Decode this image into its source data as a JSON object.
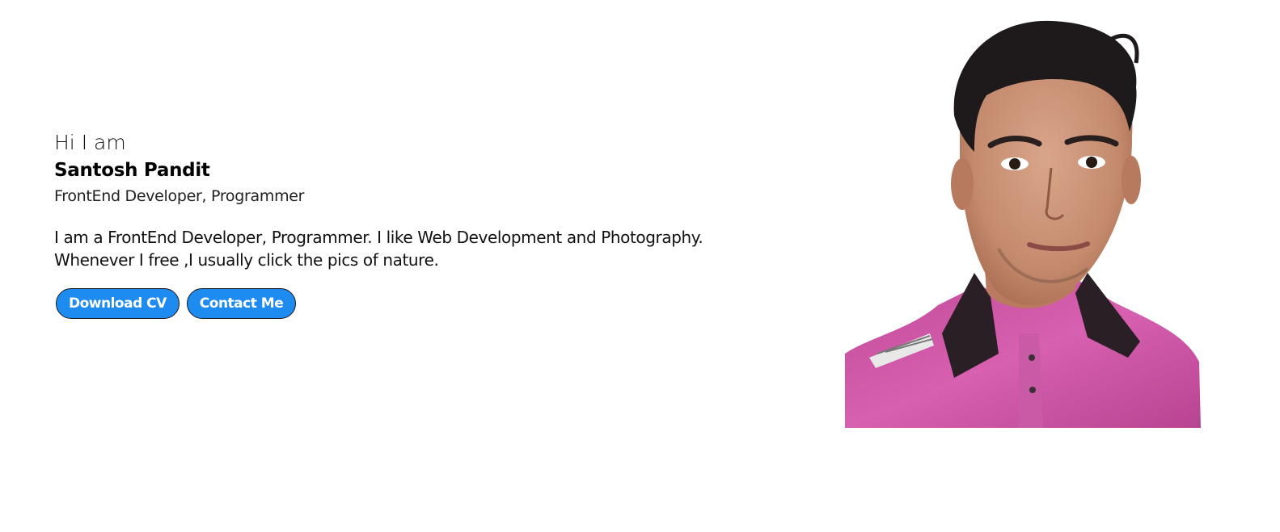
{
  "hero": {
    "greeting": "Hi I am",
    "name": "Santosh Pandit",
    "role": "FrontEnd Developer, Programmer",
    "bio_line1": "I am a FrontEnd Developer, Programmer. I like Web Development and Photography.",
    "bio_line2": "Whenever I free ,I usually click the pics of nature.",
    "download_cv_label": "Download CV",
    "contact_me_label": "Contact Me",
    "photo_alt": "Santosh Pandit",
    "accent_color": "#1e8bf0",
    "photo_icon": "profile-photo"
  }
}
